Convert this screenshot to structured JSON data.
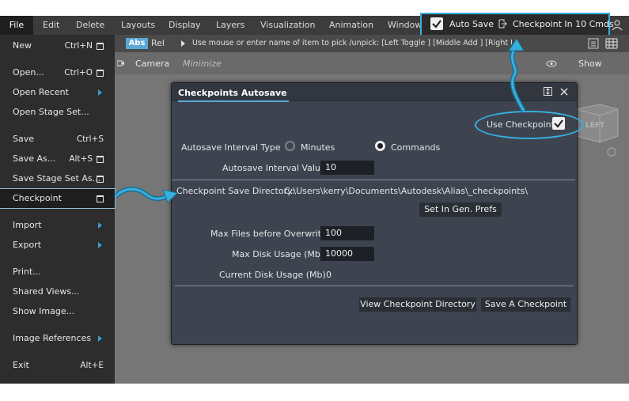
{
  "menubar": {
    "items": [
      "File",
      "Edit",
      "Delete",
      "Layouts",
      "Display",
      "Layers",
      "Visualization",
      "Animation",
      "Windows"
    ]
  },
  "topright": {
    "autosave_label": "Auto Save",
    "checkpoint_label": "Checkpoint In 10 Cmds"
  },
  "toolbar": {
    "abs": "Abs",
    "rel": "Rel",
    "prompt": "Use mouse or enter name of item to pick /unpick: [Left Toggle ] [Middle Add ] [Right Unpick]"
  },
  "subbar": {
    "camera": "Camera",
    "minimize": "Minimize",
    "show": "Show"
  },
  "viewcube_label": "LEFT",
  "file_menu": {
    "items": [
      {
        "label": "New",
        "shortcut": "Ctrl+N"
      },
      {
        "label": "Open...",
        "shortcut": "Ctrl+O"
      },
      {
        "label": "Open Recent"
      },
      {
        "label": "Open Stage Set..."
      },
      {
        "label": "Save",
        "shortcut": "Ctrl+S"
      },
      {
        "label": "Save As...",
        "shortcut": "Alt+S"
      },
      {
        "label": "Save Stage Set As..."
      },
      {
        "label": "Checkpoint"
      },
      {
        "label": "Import"
      },
      {
        "label": "Export"
      },
      {
        "label": "Print..."
      },
      {
        "label": "Shared Views..."
      },
      {
        "label": "Show Image..."
      },
      {
        "label": "Image References"
      },
      {
        "label": "Exit",
        "shortcut": "Alt+E"
      }
    ]
  },
  "dialog": {
    "title": "Checkpoints Autosave",
    "use_checkpoint": "Use Checkpoint",
    "interval_type_label": "Autosave Interval Type",
    "opt_minutes": "Minutes",
    "opt_commands": "Commands",
    "interval_value_label": "Autosave Interval Value",
    "interval_value": "10",
    "save_dir_label": "Checkpoint Save Directory:",
    "save_dir_value": "C:\\Users\\kerry\\Documents\\Autodesk\\Alias\\_checkpoints\\",
    "set_prefs_button": "Set In Gen. Prefs",
    "max_files_label": "Max Files before Overwrite",
    "max_files_value": "100",
    "max_disk_label": "Max Disk Usage (Mb)",
    "max_disk_value": "10000",
    "current_disk_label": "Current Disk Usage (Mb)",
    "current_disk_value": "0",
    "view_dir_button": "View Checkpoint Directory",
    "save_checkpoint_button": "Save A Checkpoint"
  },
  "colors": {
    "accent": "#36b0e0",
    "dialog_bg": "#3d4450",
    "menu_bg": "#2d2d2d"
  }
}
